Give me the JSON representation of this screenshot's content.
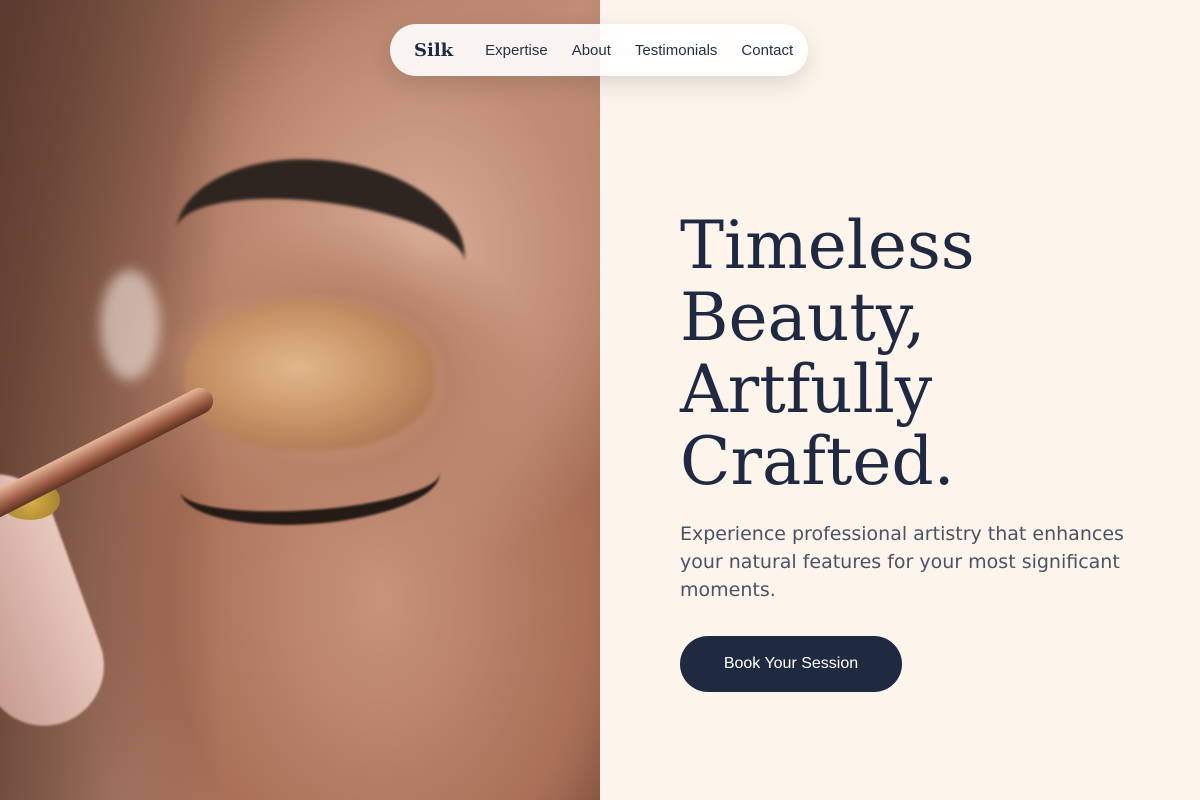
{
  "brand": "Silk",
  "nav": {
    "items": [
      "Expertise",
      "About",
      "Testimonials",
      "Contact"
    ]
  },
  "hero": {
    "headline_lines": [
      "Timeless",
      "Beauty,",
      "Artfully",
      "Crafted."
    ],
    "subtitle": "Experience professional artistry that enhances your natural features for your most significant moments.",
    "cta_label": "Book Your Session",
    "image_description": "Close-up of eye makeup application with a brush"
  },
  "colors": {
    "background": "#fdf4ec",
    "text_dark": "#1f2a42",
    "text_muted": "#4b5264",
    "button_bg": "#1f2a40"
  }
}
